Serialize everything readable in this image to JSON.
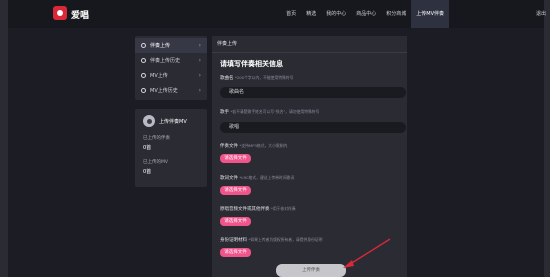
{
  "topnav": {
    "brand": "爱唱",
    "items": [
      "首页",
      "精选",
      "我的中心",
      "商品中心",
      "积分商城",
      "上传MV伴奏",
      "退出"
    ],
    "active_index": 5
  },
  "sidebar": {
    "menu": [
      {
        "label": "伴奏上传",
        "active": true
      },
      {
        "label": "伴奏上传历史",
        "active": false
      },
      {
        "label": "MV上传",
        "active": false
      },
      {
        "label": "MV上传历史",
        "active": false
      }
    ],
    "stats": {
      "title": "上传伴奏MV",
      "items": [
        {
          "label": "已上传的伴奏",
          "value": "0首"
        },
        {
          "label": "已上传的MV",
          "value": "0首"
        }
      ]
    }
  },
  "panel": {
    "header": "伴奏上传",
    "title": "请填写伴奏相关信息",
    "song_name": {
      "label": "歌曲名",
      "note": "*200个字以内，不能使用特殊符号",
      "value": "歌曲名"
    },
    "singer": {
      "label": "歌手",
      "note": "*若不清楚歌手姓名可以写\"佚名\"，请勿使用特殊符号",
      "value": "歌唱"
    },
    "accompaniment_file": {
      "label": "伴奏文件",
      "note": "*支持MP3格式，大小限制内",
      "button": "请选择文件"
    },
    "lyrics_file": {
      "label": "歌词文件",
      "note": "*LRC格式，建议上传带时间歌词",
      "button": "请选择文件"
    },
    "original_file": {
      "label": "原唱音频文件或其他伴奏",
      "note": "*用于核对伴奏",
      "button": "请选择文件"
    },
    "identity_file": {
      "label": "身份证明材料",
      "note": "*如果上传者为版权所有者，请提供身份证明",
      "button": "请选择文件"
    }
  },
  "submit": {
    "label": "上传伴奏"
  },
  "colors": {
    "accent": "#f0548a",
    "brand": "#d8283a",
    "background": "#1c1d24",
    "panel": "#2a2b33"
  }
}
